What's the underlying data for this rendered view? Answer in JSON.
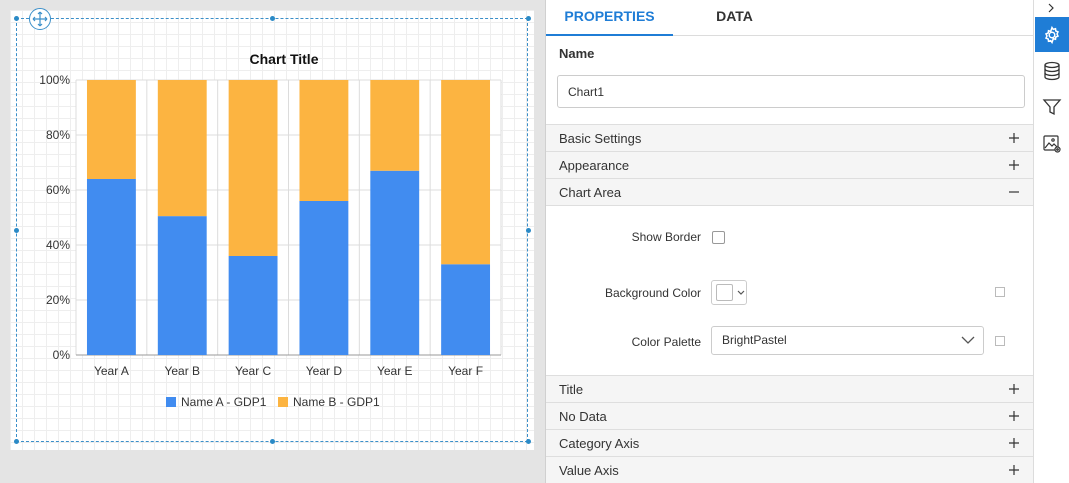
{
  "chart": {
    "title": "Chart Title",
    "legend": [
      "Name A - GDP1",
      "Name B - GDP1"
    ]
  },
  "chart_data": {
    "type": "bar",
    "stacked": "100%",
    "title": "Chart Title",
    "categories": [
      "Year A",
      "Year B",
      "Year C",
      "Year D",
      "Year E",
      "Year F"
    ],
    "series": [
      {
        "name": "Name A - GDP1",
        "color": "#418cf0",
        "values": [
          64,
          50.5,
          36,
          56,
          67,
          33
        ]
      },
      {
        "name": "Name B - GDP1",
        "color": "#fcb441",
        "values": [
          36,
          49.5,
          64,
          44,
          33,
          67
        ]
      }
    ],
    "ylim": [
      0,
      100
    ],
    "yticks": [
      "0%",
      "20%",
      "40%",
      "60%",
      "80%",
      "100%"
    ],
    "grid": true,
    "legend_position": "bottom"
  },
  "panel": {
    "tabs": {
      "properties": "PROPERTIES",
      "data": "DATA"
    },
    "name_label": "Name",
    "name_value": "Chart1",
    "sections": {
      "basic_settings": "Basic Settings",
      "appearance": "Appearance",
      "chart_area": "Chart Area",
      "title": "Title",
      "no_data": "No Data",
      "category_axis": "Category Axis",
      "value_axis": "Value Axis"
    },
    "chart_area": {
      "show_border_label": "Show Border",
      "background_color_label": "Background Color",
      "color_palette_label": "Color Palette",
      "color_palette_value": "BrightPastel"
    }
  },
  "icons": {
    "move": "move-icon",
    "collapse": "chevron-right-icon",
    "settings": "gear-icon",
    "data": "database-icon",
    "filter": "filter-icon",
    "image": "image-settings-icon"
  },
  "colors": {
    "accent": "#1f7dd6",
    "series_a": "#418cf0",
    "series_b": "#fcb441"
  }
}
